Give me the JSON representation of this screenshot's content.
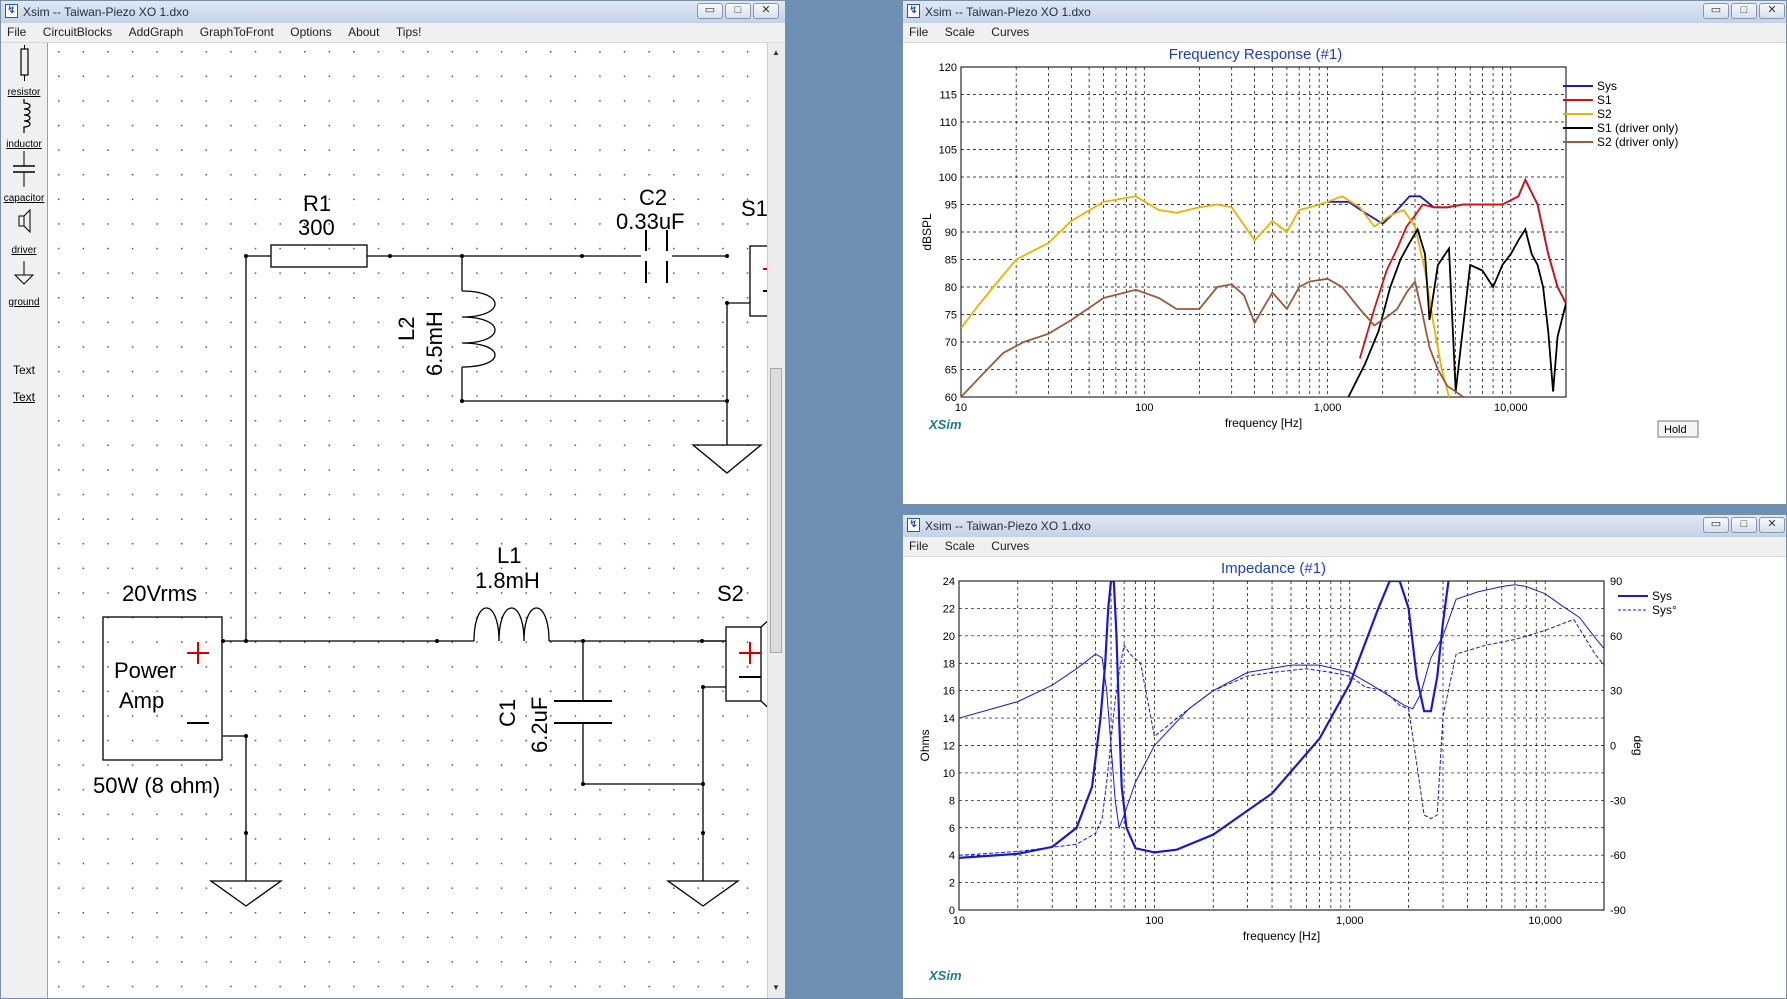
{
  "schematic_window": {
    "title": "Xsim -- Taiwan-Piezo XO 1.dxo",
    "menu": [
      "File",
      "CircuitBlocks",
      "AddGraph",
      "GraphToFront",
      "Options",
      "About",
      "Tips!"
    ],
    "palette": [
      {
        "label": "resistor",
        "icon": "resistor-icon"
      },
      {
        "label": "inductor",
        "icon": "inductor-icon"
      },
      {
        "label": "capacitor",
        "icon": "capacitor-icon"
      },
      {
        "label": "driver",
        "icon": "driver-icon"
      },
      {
        "label": "ground",
        "icon": "ground-icon"
      },
      {
        "label": "Text",
        "icon": "text-icon"
      },
      {
        "label": "Text",
        "icon": "text-link"
      }
    ],
    "components": {
      "r1_name": "R1",
      "r1_value": "300",
      "c2_name": "C2",
      "c2_value": "0.33uF",
      "s1_name": "S1",
      "l2_name": "L2",
      "l2_value": "6.5mH",
      "l1_name": "L1",
      "l1_value": "1.8mH",
      "s2_name": "S2",
      "c1_name": "C1",
      "c1_value": "6.2uF",
      "amp_voltage": "20Vrms",
      "amp_line1": "Power",
      "amp_line2": "Amp",
      "amp_power": "50W (8 ohm)"
    }
  },
  "freq_window": {
    "title": "Xsim -- Taiwan-Piezo XO 1.dxo",
    "menu": [
      "File",
      "Scale",
      "Curves"
    ],
    "watermark": "XSim",
    "hold_button": "Hold",
    "chart_data": {
      "type": "line",
      "title": "Frequency Response (#1)",
      "xlabel": "frequency [Hz]",
      "ylabel": "dBSPL",
      "x_scale": "log",
      "xlim": [
        10,
        20000
      ],
      "ylim": [
        60,
        120
      ],
      "x_tick_labels": [
        "10",
        "100",
        "1,000",
        "10,000"
      ],
      "y_ticks": [
        60,
        65,
        70,
        75,
        80,
        85,
        90,
        95,
        100,
        105,
        110,
        115,
        120
      ],
      "grid": true,
      "legend_position": "right",
      "series": [
        {
          "name": "Sys",
          "color": "#1a1acc",
          "x": [
            1000,
            1300,
            1600,
            2000,
            2400,
            2800,
            3200,
            3800,
            4500,
            5500,
            7000,
            9000,
            11000,
            12000,
            14000,
            16000,
            18000,
            20000
          ],
          "y": [
            95.5,
            95.5,
            93.5,
            91.5,
            94,
            96.5,
            96.5,
            94.5,
            94.5,
            95,
            95,
            95,
            96.5,
            99.5,
            95,
            86,
            80,
            77
          ]
        },
        {
          "name": "S1",
          "color": "#d81010",
          "x": [
            1500,
            1800,
            2100,
            2400,
            2700,
            3000,
            3300,
            3800,
            4500,
            5500,
            7000,
            9000,
            11000,
            12000,
            14000,
            16000,
            18000,
            20000
          ],
          "y": [
            67,
            76,
            83,
            87,
            91,
            93,
            95,
            94.5,
            94.5,
            95,
            95,
            95,
            96.5,
            99.5,
            95,
            86,
            80,
            77
          ]
        },
        {
          "name": "S2",
          "color": "#e8b400",
          "x": [
            10,
            12,
            15,
            20,
            30,
            40,
            60,
            90,
            120,
            150,
            200,
            250,
            300,
            400,
            500,
            600,
            700,
            800,
            1000,
            1200,
            1500,
            1800,
            2200,
            2600,
            3000,
            3400,
            3800,
            4200,
            4600
          ],
          "y": [
            72.5,
            76,
            80,
            85,
            88,
            92,
            95.5,
            96.5,
            94,
            93.5,
            94.5,
            95,
            94.5,
            88.5,
            92,
            90,
            94,
            94.5,
            95.5,
            96.5,
            94.5,
            91,
            93,
            94,
            91,
            83,
            73,
            65,
            60
          ]
        },
        {
          "name": "S1 (driver only)",
          "color": "#000000",
          "x": [
            1300,
            1600,
            1900,
            2200,
            2500,
            2800,
            3100,
            3400,
            3600,
            4000,
            4600,
            5000,
            6000,
            7000,
            8000,
            9000,
            10000,
            11000,
            12000,
            13000,
            14000,
            15000,
            16000,
            17000,
            18000,
            20000
          ],
          "y": [
            60,
            66,
            72,
            80,
            85,
            88,
            90.5,
            86,
            74,
            84,
            87,
            61,
            84,
            83,
            80,
            84,
            86,
            88.5,
            90.5,
            86,
            84,
            80,
            72,
            61,
            71,
            77
          ]
        },
        {
          "name": "S2 (driver only)",
          "color": "#9b5a3a",
          "x": [
            10,
            13,
            17,
            22,
            30,
            40,
            60,
            90,
            120,
            150,
            200,
            250,
            300,
            350,
            400,
            500,
            600,
            700,
            800,
            1000,
            1200,
            1500,
            1800,
            2100,
            2400,
            2700,
            3000,
            3300,
            3600,
            4000,
            4500,
            5000,
            5500
          ],
          "y": [
            60,
            64,
            68,
            70,
            71.5,
            74,
            78,
            79.5,
            78,
            76,
            76,
            80,
            80.5,
            78.5,
            73.5,
            79,
            76,
            80,
            81,
            81.5,
            80,
            76,
            73,
            74.5,
            76,
            79,
            81,
            75,
            69,
            65,
            62,
            61,
            60
          ]
        }
      ]
    }
  },
  "imp_window": {
    "title": "Xsim -- Taiwan-Piezo XO 1.dxo",
    "menu": [
      "File",
      "Scale",
      "Curves"
    ],
    "watermark": "XSim",
    "chart_data": {
      "type": "line",
      "title": "Impedance (#1)",
      "xlabel": "frequency [Hz]",
      "ylabel": "Ohms",
      "y2label": "deg",
      "x_scale": "log",
      "xlim": [
        10,
        20000
      ],
      "ylim": [
        0,
        24
      ],
      "y2lim": [
        -90,
        90
      ],
      "x_tick_labels": [
        "10",
        "100",
        "1,000",
        "10,000"
      ],
      "y_ticks": [
        0,
        2,
        4,
        6,
        8,
        10,
        12,
        14,
        16,
        18,
        20,
        22,
        24
      ],
      "y2_ticks": [
        -90,
        -60,
        -30,
        0,
        30,
        60,
        90
      ],
      "grid": true,
      "legend_position": "right",
      "series": [
        {
          "name": "Sys",
          "color": "#1a1acc",
          "axis": "left",
          "x": [
            10,
            20,
            30,
            40,
            48,
            53,
            56,
            58,
            60,
            62,
            64,
            66,
            68,
            72,
            80,
            100,
            130,
            200,
            400,
            700,
            1000,
            1400,
            1600,
            1800,
            2000,
            2200,
            2400,
            2600,
            2800,
            3000,
            3200
          ],
          "y": [
            3.8,
            4.1,
            4.6,
            6,
            9,
            14,
            18,
            22,
            24,
            24,
            20,
            14,
            9,
            6,
            4.5,
            4.2,
            4.4,
            5.5,
            8.5,
            12.5,
            16.5,
            22,
            24,
            24,
            22,
            17,
            14.5,
            14.5,
            17,
            21,
            24
          ]
        },
        {
          "name": "Sys°",
          "color": "#1a1acc",
          "axis": "right",
          "dashed": true,
          "x": [
            10,
            20,
            40,
            50,
            54,
            57,
            59,
            61,
            63,
            66,
            70,
            75,
            85,
            100,
            150,
            200,
            300,
            400,
            600,
            800,
            1000,
            1200,
            1500,
            1800,
            2000,
            2200,
            2400,
            2600,
            2800,
            3000,
            3500,
            5000,
            7000,
            10000,
            14000,
            18000,
            20000
          ],
          "y": [
            -60,
            -58,
            -54,
            -48,
            -40,
            -20,
            -5,
            10,
            25,
            40,
            55,
            50,
            45,
            5,
            20,
            30,
            38,
            40,
            42,
            40,
            38,
            32,
            30,
            22,
            20,
            -10,
            -38,
            -40,
            -38,
            16,
            50,
            55,
            58,
            63,
            69,
            50,
            44
          ]
        },
        {
          "name": "deg",
          "color": "#1a1acc",
          "axis": "right",
          "x": [
            10,
            20,
            30,
            40,
            50,
            54,
            57,
            60,
            63,
            66,
            70,
            80,
            100,
            150,
            200,
            300,
            500,
            700,
            1000,
            1300,
            1600,
            1900,
            2100,
            2300,
            2600,
            3000,
            3500,
            4500,
            6000,
            7000,
            8000,
            10000,
            12000,
            15000,
            18000,
            20000
          ],
          "y": [
            15,
            24,
            33,
            42,
            50,
            48,
            30,
            0,
            -30,
            -45,
            -38,
            -20,
            0,
            20,
            30,
            40,
            44,
            44,
            40,
            33,
            27,
            22,
            20,
            28,
            48,
            60,
            80,
            84,
            87,
            88,
            87,
            83,
            77,
            70,
            59,
            53
          ]
        }
      ]
    }
  }
}
